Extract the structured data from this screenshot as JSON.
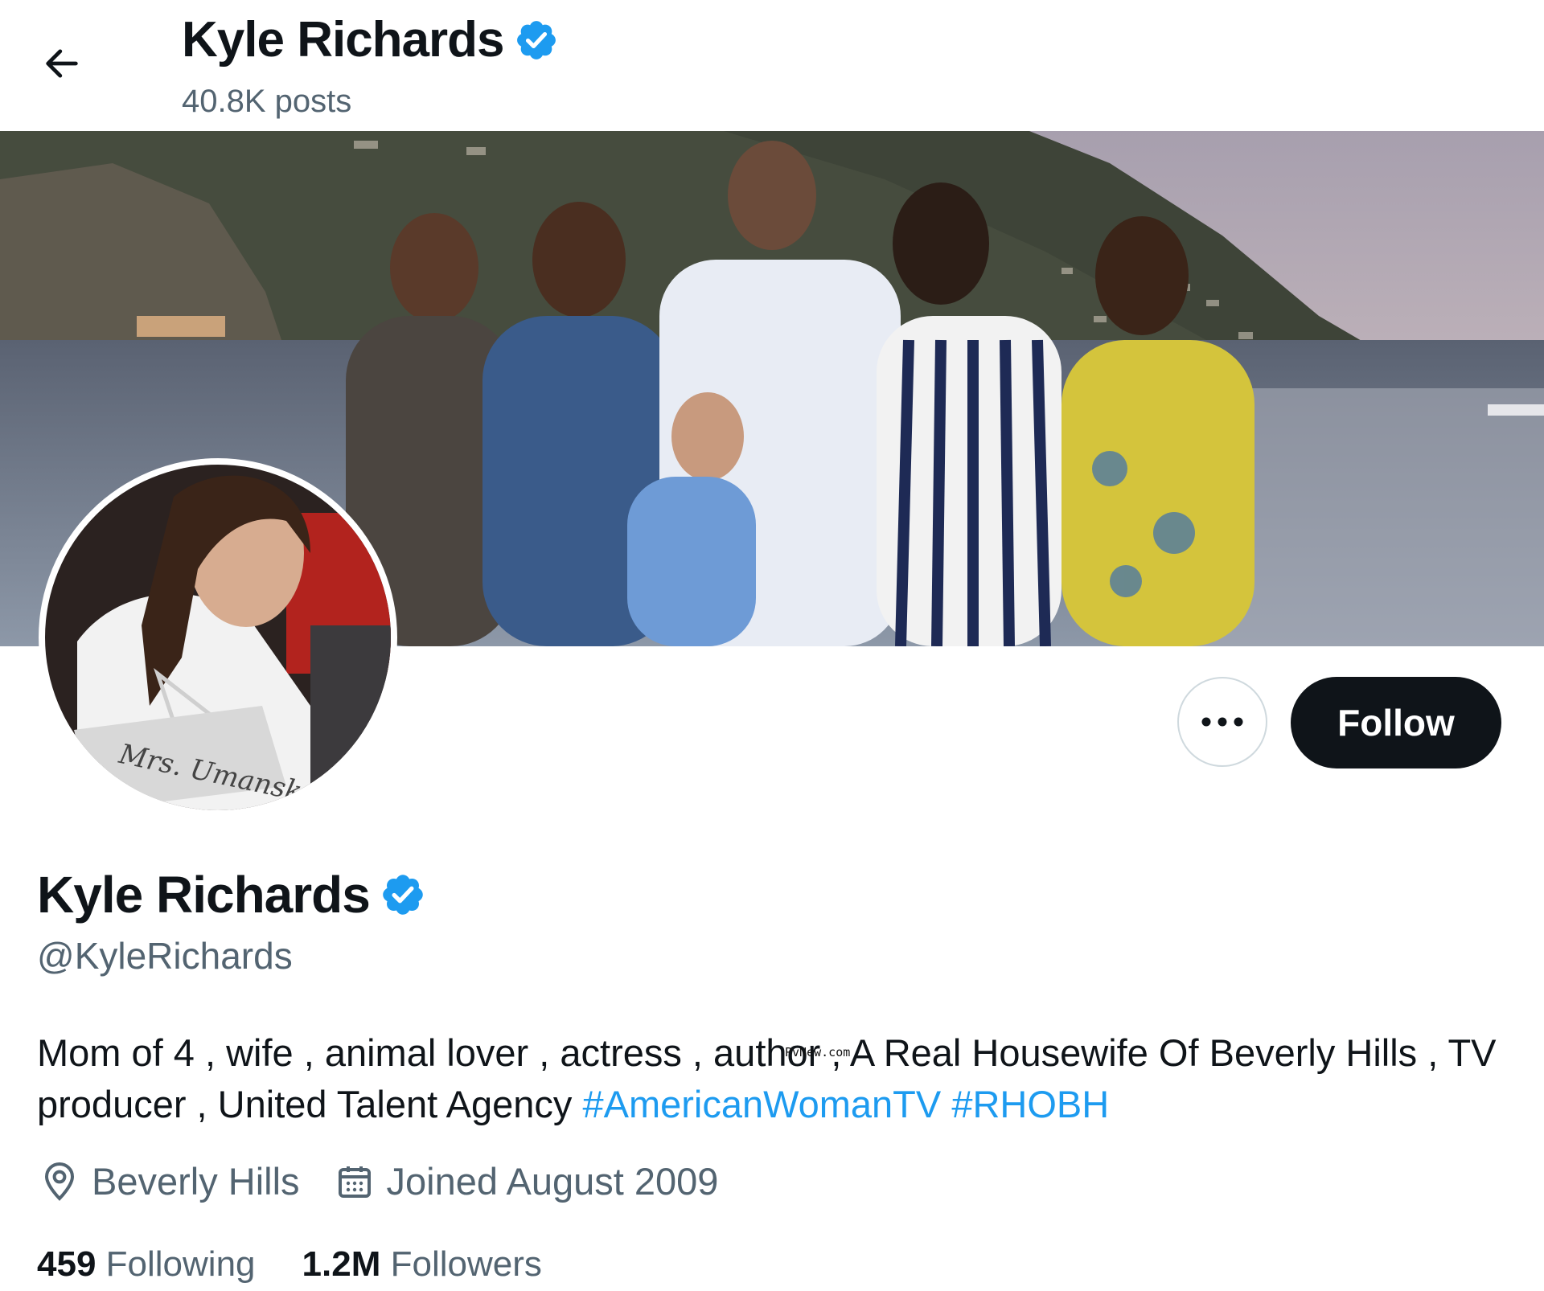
{
  "header": {
    "name": "Kyle Richards",
    "posts": "40.8K posts"
  },
  "profile": {
    "name": "Kyle Richards",
    "handle": "@KyleRichards",
    "bio_text": "Mom of 4 , wife , animal lover , actress , author , A Real Housewife Of Beverly Hills , TV producer ,  United Talent Agency ",
    "hashtags": [
      "#AmericanWomanTV",
      "#RHOBH"
    ],
    "location": "Beverly Hills",
    "joined": "Joined August 2009",
    "following_count": "459",
    "following_label": "Following",
    "followers_count": "1.2M",
    "followers_label": "Followers"
  },
  "actions": {
    "more_label": "•••",
    "follow_label": "Follow"
  },
  "avatar_caption": "Mrs. Umansky",
  "watermark": "PvNew.com",
  "icons": {
    "back": "arrow-left-icon",
    "verified": "verified-badge-icon",
    "location": "location-pin-icon",
    "calendar": "calendar-icon",
    "more": "more-dots-icon"
  },
  "colors": {
    "accent": "#1d9bf0",
    "text": "#0f1419",
    "secondary": "#536471",
    "follow_bg": "#0f1419"
  }
}
